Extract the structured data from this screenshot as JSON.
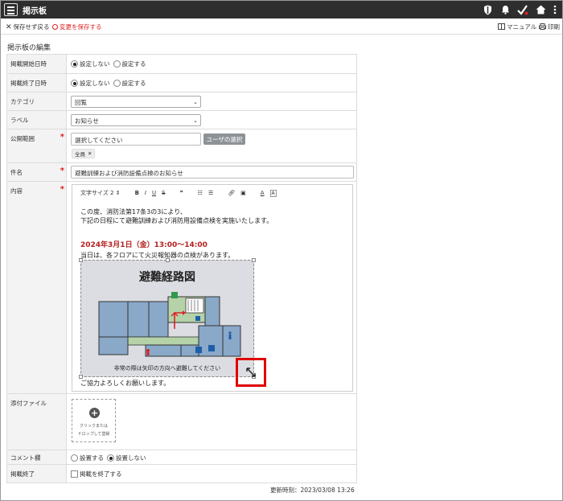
{
  "app": {
    "title": "掲示板"
  },
  "toolbar": {
    "discard_label": "保存せず戻る",
    "save_label": "変更を保存する",
    "manual_label": "マニュアル",
    "print_label": "印刷"
  },
  "section": {
    "title": "掲示板の編集"
  },
  "form": {
    "start_date": {
      "label": "掲載開始日時",
      "options": [
        "設定しない",
        "設定する"
      ],
      "selected": "設定しない"
    },
    "end_date": {
      "label": "掲載終了日時",
      "options": [
        "設定しない",
        "設定する"
      ],
      "selected": "設定しない"
    },
    "category": {
      "label": "カテゴリ",
      "value": "回覧"
    },
    "label_field": {
      "label": "ラベル",
      "value": "お知らせ"
    },
    "scope": {
      "label": "公開範囲",
      "placeholder": "選択してください",
      "button": "ユーザの選択",
      "tag": "全員",
      "tag_remove": "✕"
    },
    "subject": {
      "label": "件名",
      "value": "避難訓練および消防設備点検のお知らせ"
    },
    "content": {
      "label": "内容",
      "font_size_label": "文字サイズ 2",
      "line1": "この度、消防法第17条3の3により、",
      "line2": "下記の日程にて避難訓練および消防用設備点検を実施いたします。",
      "date_line": "2024年3月1日（金）13:00～14:00",
      "note": "当日は、各フロアにて火災報知器の点検があります。",
      "closing": "ご協力よろしくお願いします。",
      "image_title": "避難経路図",
      "image_caption": "非常の際は矢印の方向へ避難してください"
    },
    "attachments": {
      "label": "添付ファイル",
      "drop_text_1": "クリックまたは",
      "drop_text_2": "ドロップして登録"
    },
    "comments": {
      "label": "コメント欄",
      "options": [
        "設置する",
        "設置しない"
      ],
      "selected": "設置しない"
    },
    "end_posting": {
      "label": "掲載終了",
      "checkbox_label": "掲載を終了する"
    }
  },
  "footer": {
    "updated": "更新時刻：2023/03/08 13:26"
  },
  "colors": {
    "topbar": "#2e2e2e",
    "required": "#e02020",
    "date_text": "#b42020",
    "highlight": "#e00000"
  }
}
